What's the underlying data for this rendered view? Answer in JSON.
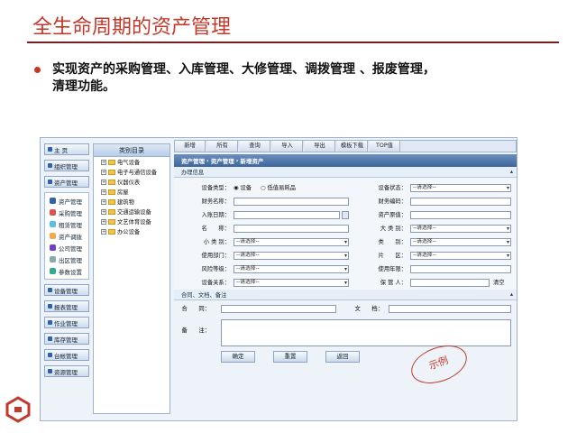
{
  "slide": {
    "title": "全生命周期的资产管理",
    "bullet_line1": "实现资产的采购管理、入库管理、大修管理、调拨管理 、报废管理，",
    "bullet_line2": "清理功能。"
  },
  "colors": {
    "accent": "#c0392b",
    "rule": "#7a1f1f",
    "header_blue": "#3d659b"
  },
  "leftnav": {
    "top": [
      {
        "label": "主 页"
      },
      {
        "label": "组织管理"
      },
      {
        "label": "资产管理"
      }
    ],
    "sub": [
      {
        "label": "资产管理",
        "icon": "#2f62a8"
      },
      {
        "label": "采购管理",
        "icon": "#d9534f"
      },
      {
        "label": "租赁管理",
        "icon": "#5bc0de"
      },
      {
        "label": "资产调拨",
        "icon": "#f0ad4e"
      },
      {
        "label": "公司管理",
        "icon": "#6f42c1"
      },
      {
        "label": "出区管理",
        "icon": "#8aa"
      },
      {
        "label": "参数设置",
        "icon": "#3a8"
      }
    ],
    "bottom": [
      {
        "label": "设备管理"
      },
      {
        "label": "报表管理"
      },
      {
        "label": "作业管理"
      },
      {
        "label": "库存管理"
      },
      {
        "label": "台帐管理"
      },
      {
        "label": "资源管理"
      }
    ]
  },
  "tree": {
    "title": "类别目录",
    "items": [
      "电气设备",
      "电子与通信设备",
      "仪器仪表",
      "房屋",
      "建筑物",
      "交通运输设备",
      "文艺体育设备",
      "办公设备"
    ]
  },
  "toolbar": [
    "新增",
    "所有",
    "查询",
    "导入",
    "导出",
    "模板下载",
    "TOP值"
  ],
  "breadcrumb": [
    "资产管理",
    "资产管理",
    "新增资产"
  ],
  "section1": "办理信息",
  "form": {
    "r1": {
      "l": "设备类型：",
      "radio1": "设备",
      "radio2": "低值易耗品",
      "r": "设备状态：",
      "rsel": "--请选择--"
    },
    "r2": {
      "l": "财务名称：",
      "r": "财务编码："
    },
    "r3": {
      "l": "入账日期：",
      "r": "资产原值："
    },
    "r4": {
      "l": "名　　称：",
      "r": "大 类 别：",
      "rsel": "--请选择--"
    },
    "r5": {
      "l": "小 类 别：",
      "lsel": "--请选择--",
      "r": "类　　别：",
      "rsel": "--请选择--"
    },
    "r6": {
      "l": "使用部门：",
      "lsel": "--请选择--",
      "r": "片　　区：",
      "rsel": "--请选择--"
    },
    "r7": {
      "l": "风险等级：",
      "lsel": "--请选择--",
      "r": "使用年限："
    },
    "r8": {
      "l": "设备关系：",
      "lsel": "--请选择--",
      "r": "保 管 人：",
      "clear": "清空"
    }
  },
  "section2": "合同、文档、备注",
  "attach": {
    "contract": "合　　同：",
    "doc": "文　　档：",
    "note": "备　　注："
  },
  "buttons": {
    "ok": "确定",
    "reset": "重置",
    "back": "返回"
  },
  "stamp": "示例"
}
